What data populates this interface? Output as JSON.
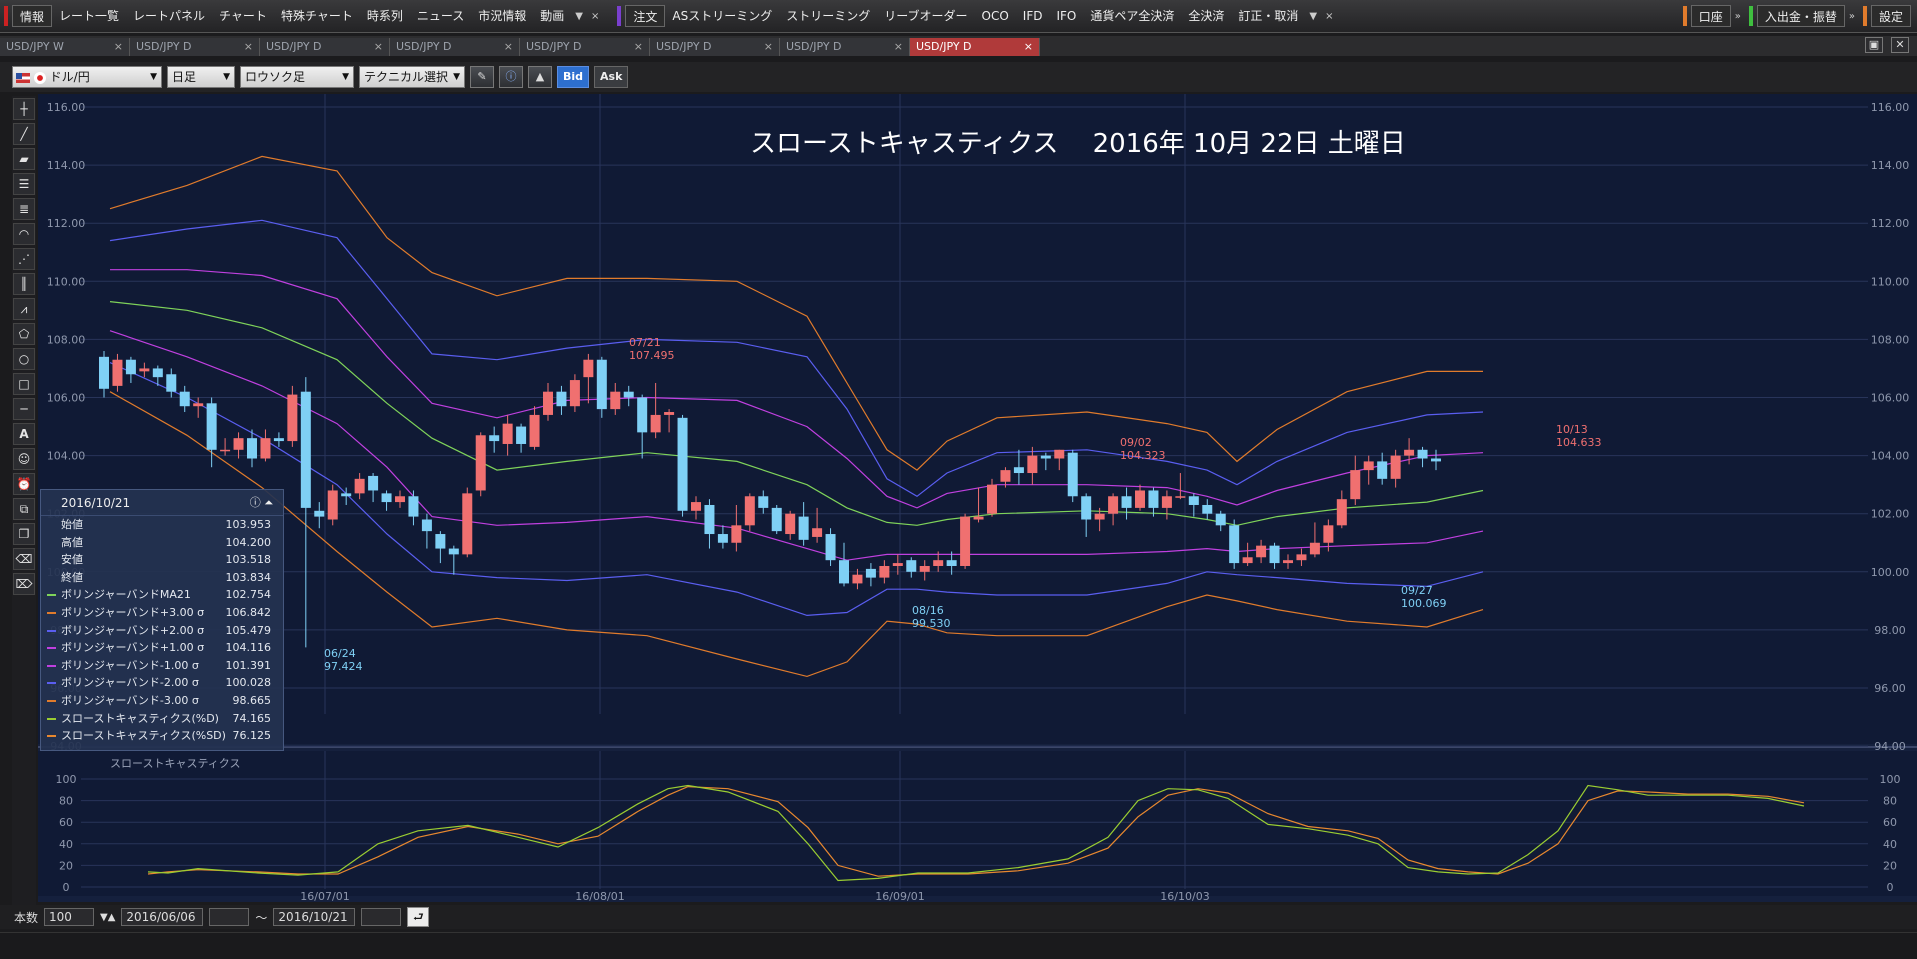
{
  "menubar": {
    "left_items": [
      "情報",
      "レート一覧",
      "レートパネル",
      "チャート",
      "特殊チャート",
      "時系列",
      "ニュース",
      "市況情報",
      "動画"
    ],
    "order_items": [
      "注文",
      "ASストリーミング",
      "ストリーミング",
      "リーブオーダー",
      "OCO",
      "IFD",
      "IFO",
      "通貨ペア全決済",
      "全決済",
      "訂正・取消"
    ],
    "account": "口座",
    "deposit": "入出金・振替",
    "settings": "設定",
    "more_arrow": "▼",
    "close_x": "×",
    "chevrons": "»"
  },
  "tabs": [
    {
      "label": "USD/JPY W",
      "active": false
    },
    {
      "label": "USD/JPY D",
      "active": false
    },
    {
      "label": "USD/JPY D",
      "active": false
    },
    {
      "label": "USD/JPY D",
      "active": false
    },
    {
      "label": "USD/JPY D",
      "active": false
    },
    {
      "label": "USD/JPY D",
      "active": false
    },
    {
      "label": "USD/JPY D",
      "active": false
    },
    {
      "label": "USD/JPY D",
      "active": true
    }
  ],
  "tab_close": "×",
  "toolbar": {
    "pair": "ドル/円",
    "period": "日足",
    "chart_style": "ロウソク足",
    "technical": "テクニカル選択",
    "bid": "Bid",
    "ask": "Ask"
  },
  "overlay_title": "スローストキャスティクス　 2016年 10月 22日 土曜日",
  "stoch_label": "スローストキャスティクス",
  "info": {
    "date": "2016/10/21",
    "rows": [
      {
        "label": "始値",
        "value": "103.953",
        "color": ""
      },
      {
        "label": "高値",
        "value": "104.200",
        "color": ""
      },
      {
        "label": "安値",
        "value": "103.518",
        "color": ""
      },
      {
        "label": "終値",
        "value": "103.834",
        "color": ""
      },
      {
        "label": "ボリンジャーバンドMA21",
        "value": "102.754",
        "color": "#7fd35a"
      },
      {
        "label": "ボリンジャーバンド+3.00 σ",
        "value": "106.842",
        "color": "#e07b2c"
      },
      {
        "label": "ボリンジャーバンド+2.00 σ",
        "value": "105.479",
        "color": "#5a5ef0"
      },
      {
        "label": "ボリンジャーバンド+1.00 σ",
        "value": "104.116",
        "color": "#c040e0"
      },
      {
        "label": "ボリンジャーバンド-1.00 σ",
        "value": "101.391",
        "color": "#c040e0"
      },
      {
        "label": "ボリンジャーバンド-2.00 σ",
        "value": "100.028",
        "color": "#5a5ef0"
      },
      {
        "label": "ボリンジャーバンド-3.00 σ",
        "value": "98.665",
        "color": "#e07b2c"
      },
      {
        "label": "スローストキャスティクス(%D)",
        "value": "74.165",
        "color": "#9acd32"
      },
      {
        "label": "スローストキャスティクス(%SD)",
        "value": "76.125",
        "color": "#e8882f"
      }
    ]
  },
  "statusbar": {
    "count_label": "本数",
    "count_value": "100",
    "from_date": "2016/06/06",
    "tilde": "～",
    "to_date": "2016/10/21"
  },
  "chart_data": {
    "type": "candlestick",
    "y_ticks": [
      "116.00",
      "114.00",
      "112.00",
      "110.00",
      "108.00",
      "106.00",
      "104.00",
      "102.00",
      "100.00",
      "98.00",
      "96.00",
      "94.00"
    ],
    "ylim": [
      94,
      116
    ],
    "x_ticks": [
      "16/07/01",
      "16/08/01",
      "16/09/01",
      "16/10/03"
    ],
    "stoch_ticks": [
      "100",
      "80",
      "60",
      "40",
      "20",
      "0"
    ],
    "annotations": [
      {
        "date": "06/24",
        "value": "97.424",
        "kind": "low"
      },
      {
        "date": "07/21",
        "value": "107.495",
        "kind": "high"
      },
      {
        "date": "08/16",
        "value": "99.530",
        "kind": "low"
      },
      {
        "date": "09/02",
        "value": "104.323",
        "kind": "high"
      },
      {
        "date": "09/27",
        "value": "100.069",
        "kind": "low"
      },
      {
        "date": "10/13",
        "value": "104.633",
        "kind": "high"
      }
    ],
    "colors": {
      "up": "#f07070",
      "down": "#7fd0f5",
      "background": "#0f1730"
    }
  }
}
